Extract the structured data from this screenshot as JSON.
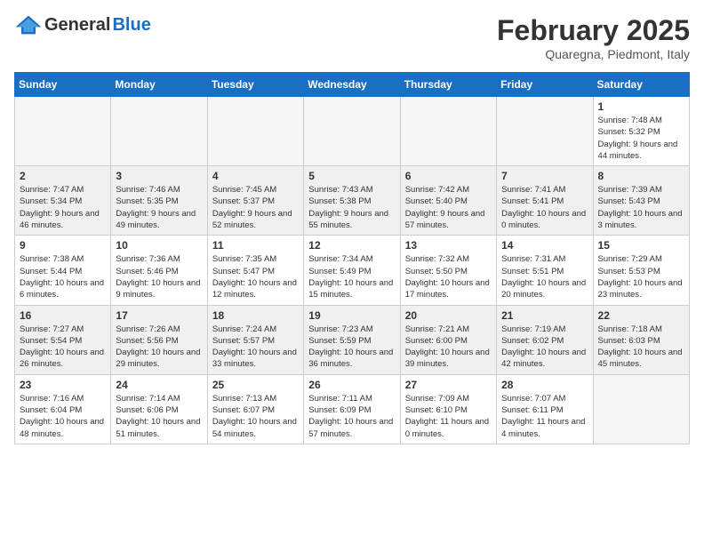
{
  "header": {
    "logo_general": "General",
    "logo_blue": "Blue",
    "month_title": "February 2025",
    "location": "Quaregna, Piedmont, Italy"
  },
  "days_of_week": [
    "Sunday",
    "Monday",
    "Tuesday",
    "Wednesday",
    "Thursday",
    "Friday",
    "Saturday"
  ],
  "weeks": [
    {
      "alt": false,
      "days": [
        {
          "num": "",
          "info": ""
        },
        {
          "num": "",
          "info": ""
        },
        {
          "num": "",
          "info": ""
        },
        {
          "num": "",
          "info": ""
        },
        {
          "num": "",
          "info": ""
        },
        {
          "num": "",
          "info": ""
        },
        {
          "num": "1",
          "info": "Sunrise: 7:48 AM\nSunset: 5:32 PM\nDaylight: 9 hours and 44 minutes."
        }
      ]
    },
    {
      "alt": true,
      "days": [
        {
          "num": "2",
          "info": "Sunrise: 7:47 AM\nSunset: 5:34 PM\nDaylight: 9 hours and 46 minutes."
        },
        {
          "num": "3",
          "info": "Sunrise: 7:46 AM\nSunset: 5:35 PM\nDaylight: 9 hours and 49 minutes."
        },
        {
          "num": "4",
          "info": "Sunrise: 7:45 AM\nSunset: 5:37 PM\nDaylight: 9 hours and 52 minutes."
        },
        {
          "num": "5",
          "info": "Sunrise: 7:43 AM\nSunset: 5:38 PM\nDaylight: 9 hours and 55 minutes."
        },
        {
          "num": "6",
          "info": "Sunrise: 7:42 AM\nSunset: 5:40 PM\nDaylight: 9 hours and 57 minutes."
        },
        {
          "num": "7",
          "info": "Sunrise: 7:41 AM\nSunset: 5:41 PM\nDaylight: 10 hours and 0 minutes."
        },
        {
          "num": "8",
          "info": "Sunrise: 7:39 AM\nSunset: 5:43 PM\nDaylight: 10 hours and 3 minutes."
        }
      ]
    },
    {
      "alt": false,
      "days": [
        {
          "num": "9",
          "info": "Sunrise: 7:38 AM\nSunset: 5:44 PM\nDaylight: 10 hours and 6 minutes."
        },
        {
          "num": "10",
          "info": "Sunrise: 7:36 AM\nSunset: 5:46 PM\nDaylight: 10 hours and 9 minutes."
        },
        {
          "num": "11",
          "info": "Sunrise: 7:35 AM\nSunset: 5:47 PM\nDaylight: 10 hours and 12 minutes."
        },
        {
          "num": "12",
          "info": "Sunrise: 7:34 AM\nSunset: 5:49 PM\nDaylight: 10 hours and 15 minutes."
        },
        {
          "num": "13",
          "info": "Sunrise: 7:32 AM\nSunset: 5:50 PM\nDaylight: 10 hours and 17 minutes."
        },
        {
          "num": "14",
          "info": "Sunrise: 7:31 AM\nSunset: 5:51 PM\nDaylight: 10 hours and 20 minutes."
        },
        {
          "num": "15",
          "info": "Sunrise: 7:29 AM\nSunset: 5:53 PM\nDaylight: 10 hours and 23 minutes."
        }
      ]
    },
    {
      "alt": true,
      "days": [
        {
          "num": "16",
          "info": "Sunrise: 7:27 AM\nSunset: 5:54 PM\nDaylight: 10 hours and 26 minutes."
        },
        {
          "num": "17",
          "info": "Sunrise: 7:26 AM\nSunset: 5:56 PM\nDaylight: 10 hours and 29 minutes."
        },
        {
          "num": "18",
          "info": "Sunrise: 7:24 AM\nSunset: 5:57 PM\nDaylight: 10 hours and 33 minutes."
        },
        {
          "num": "19",
          "info": "Sunrise: 7:23 AM\nSunset: 5:59 PM\nDaylight: 10 hours and 36 minutes."
        },
        {
          "num": "20",
          "info": "Sunrise: 7:21 AM\nSunset: 6:00 PM\nDaylight: 10 hours and 39 minutes."
        },
        {
          "num": "21",
          "info": "Sunrise: 7:19 AM\nSunset: 6:02 PM\nDaylight: 10 hours and 42 minutes."
        },
        {
          "num": "22",
          "info": "Sunrise: 7:18 AM\nSunset: 6:03 PM\nDaylight: 10 hours and 45 minutes."
        }
      ]
    },
    {
      "alt": false,
      "days": [
        {
          "num": "23",
          "info": "Sunrise: 7:16 AM\nSunset: 6:04 PM\nDaylight: 10 hours and 48 minutes."
        },
        {
          "num": "24",
          "info": "Sunrise: 7:14 AM\nSunset: 6:06 PM\nDaylight: 10 hours and 51 minutes."
        },
        {
          "num": "25",
          "info": "Sunrise: 7:13 AM\nSunset: 6:07 PM\nDaylight: 10 hours and 54 minutes."
        },
        {
          "num": "26",
          "info": "Sunrise: 7:11 AM\nSunset: 6:09 PM\nDaylight: 10 hours and 57 minutes."
        },
        {
          "num": "27",
          "info": "Sunrise: 7:09 AM\nSunset: 6:10 PM\nDaylight: 11 hours and 0 minutes."
        },
        {
          "num": "28",
          "info": "Sunrise: 7:07 AM\nSunset: 6:11 PM\nDaylight: 11 hours and 4 minutes."
        },
        {
          "num": "",
          "info": ""
        }
      ]
    }
  ]
}
